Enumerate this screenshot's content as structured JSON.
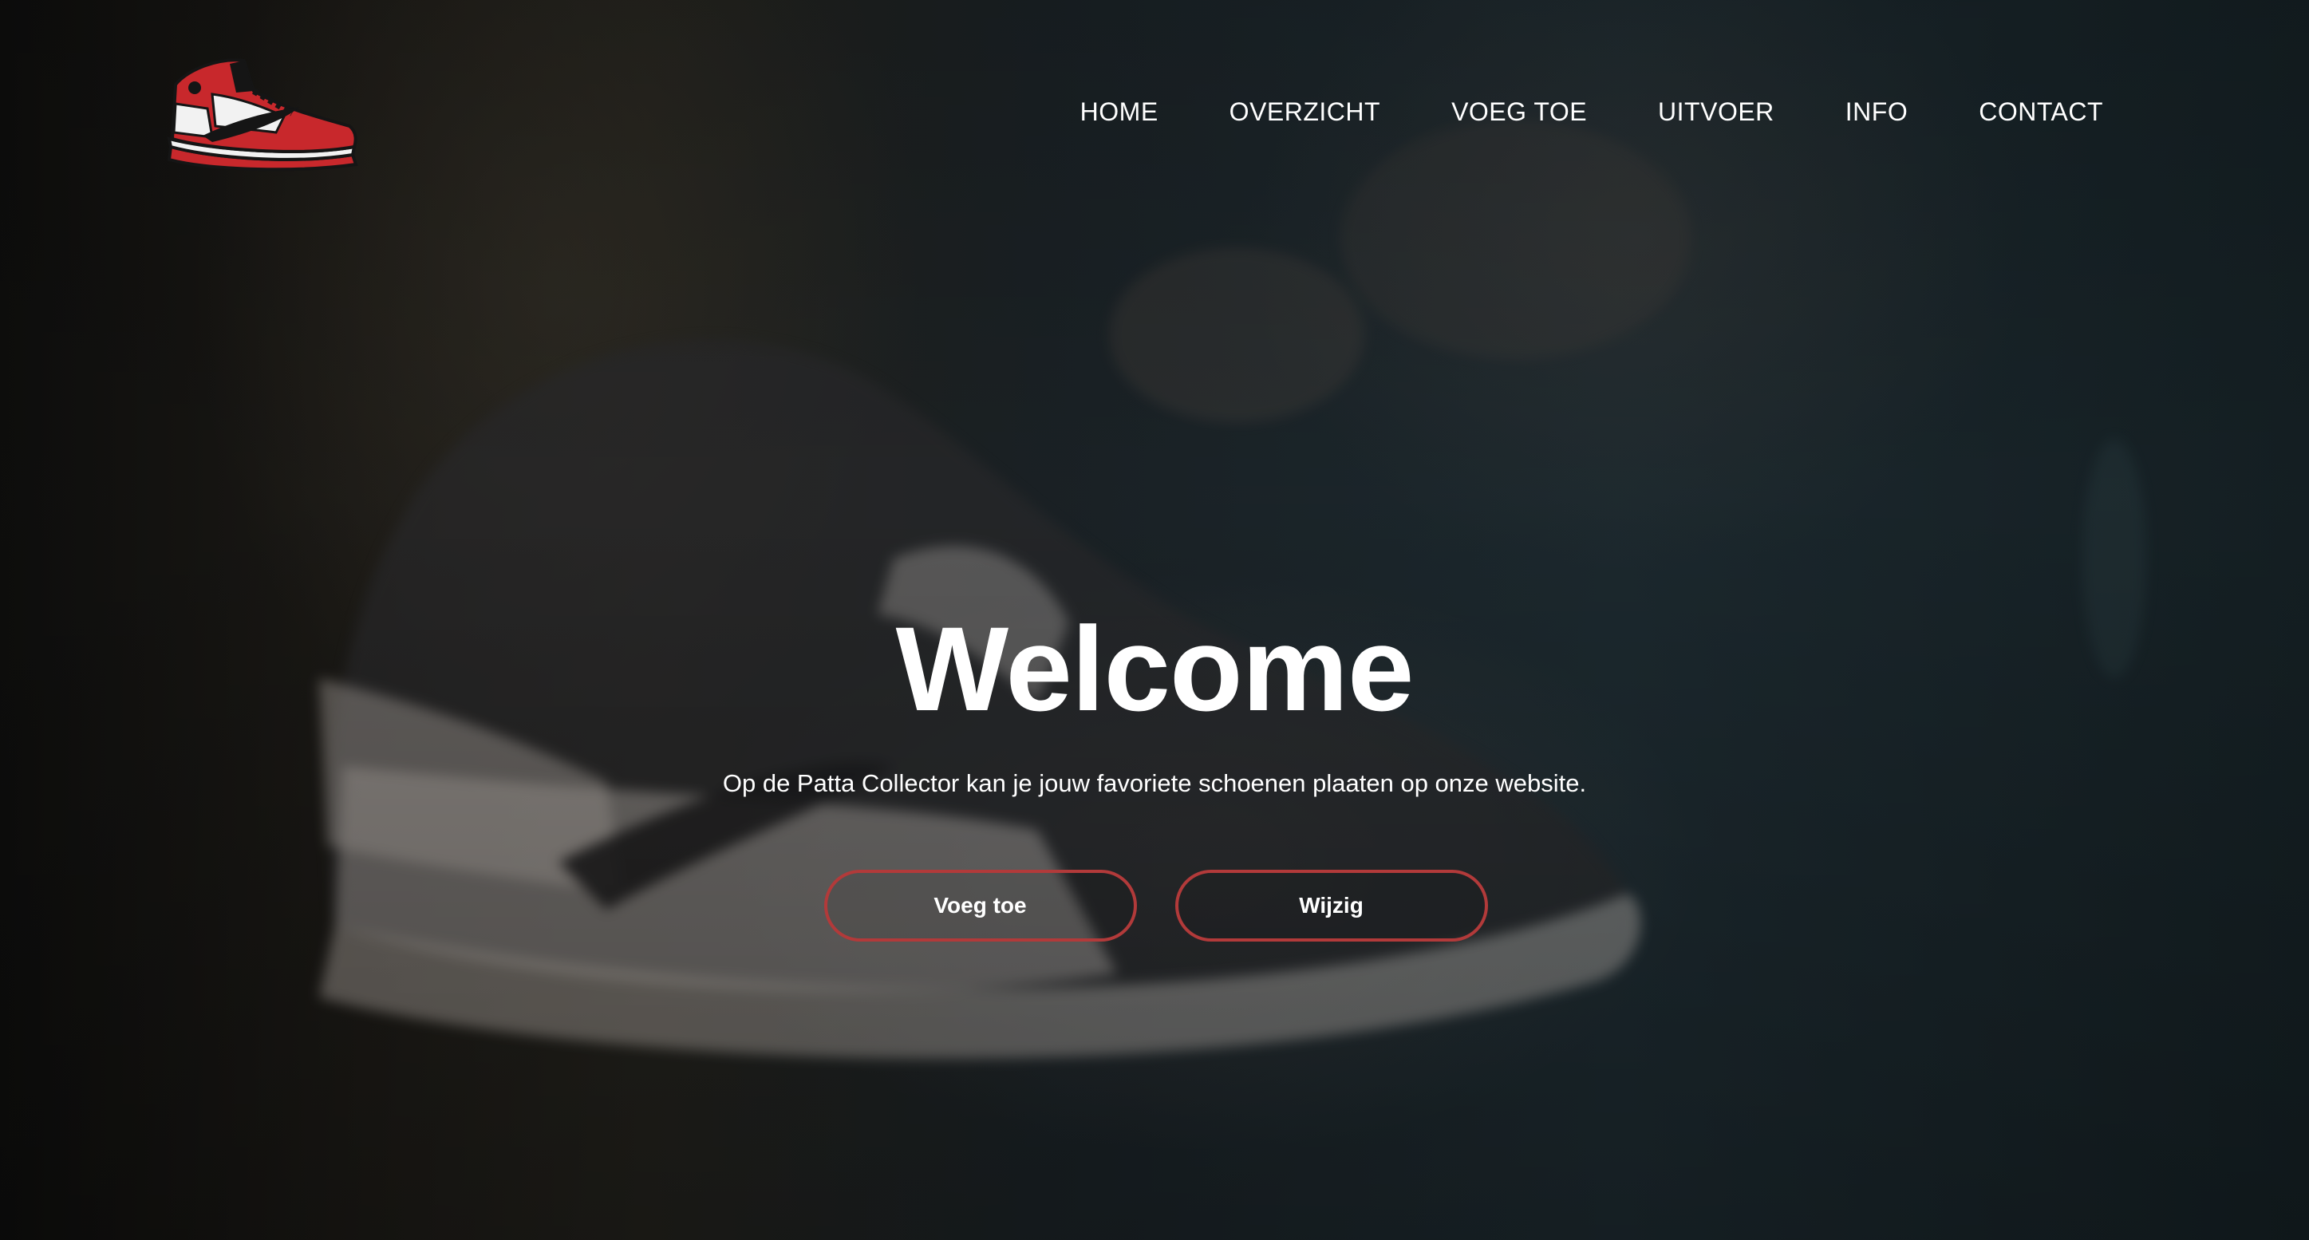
{
  "logo": {
    "icon": "sneaker-logo-icon",
    "colors": {
      "red": "#c8282c",
      "white": "#f2f2f2",
      "black": "#151515"
    }
  },
  "nav": {
    "items": [
      {
        "label": "HOME"
      },
      {
        "label": "OVERZICHT"
      },
      {
        "label": "VOEG TOE"
      },
      {
        "label": "UITVOER"
      },
      {
        "label": "INFO"
      },
      {
        "label": "CONTACT"
      }
    ]
  },
  "hero": {
    "title": "Welcome",
    "subtitle": "Op de Patta Collector kan je jouw favoriete schoenen plaaten op onze website.",
    "buttons": {
      "add_label": "Voeg toe",
      "edit_label": "Wijzig"
    },
    "accent_color": "#b23a3a"
  }
}
